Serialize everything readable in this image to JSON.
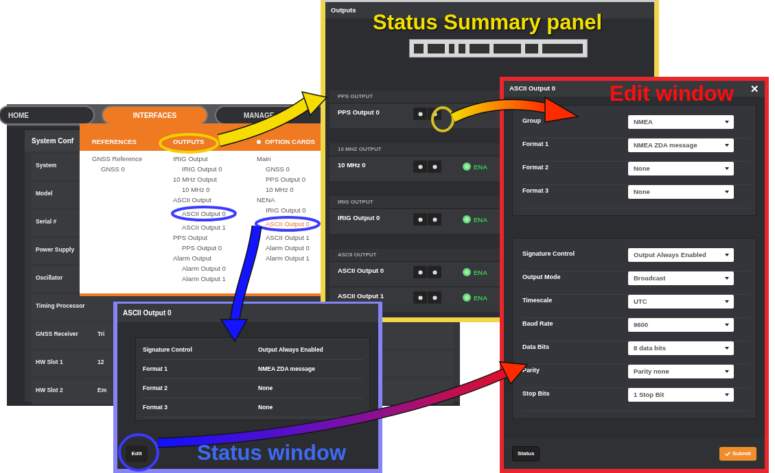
{
  "system_screen": {
    "nav_tabs": [
      {
        "label": "HOME",
        "selected": false
      },
      {
        "label": "INTERFACES",
        "selected": true
      },
      {
        "label": "MANAGE",
        "selected": false
      }
    ],
    "panel_title": "System Conf",
    "rows": [
      {
        "label": "System"
      },
      {
        "label": "Model"
      },
      {
        "label": "Serial #"
      },
      {
        "label": "Power Supply"
      },
      {
        "label": "Oscillator"
      },
      {
        "label": "Timing Processor"
      },
      {
        "label": "GNSS Receiver",
        "value": "Tri"
      },
      {
        "label": "HW Slot 1",
        "value": "12"
      },
      {
        "label": "HW Slot 2",
        "value": "Em"
      }
    ]
  },
  "interfaces_menu": {
    "columns": [
      {
        "heading": "REFERENCES",
        "dot": false,
        "items": [
          {
            "label": "GNSS Reference",
            "selected": false,
            "children": [
              {
                "label": "GNSS 0",
                "selected": false
              }
            ]
          }
        ]
      },
      {
        "heading": "OUTPUTS",
        "dot": false,
        "items": [
          {
            "label": "IRIG Output",
            "selected": false,
            "children": [
              {
                "label": "IRIG Output 0",
                "selected": false
              }
            ]
          },
          {
            "label": "10 MHz Output",
            "selected": false,
            "children": [
              {
                "label": "10 MHz 0",
                "selected": false
              }
            ]
          },
          {
            "label": "ASCII Output",
            "selected": false,
            "children": [
              {
                "label": "ASCII Output 0",
                "selected": false
              },
              {
                "label": "ASCII Output 1",
                "selected": false
              }
            ]
          },
          {
            "label": "PPS Output",
            "selected": false,
            "children": [
              {
                "label": "PPS Output 0",
                "selected": false
              }
            ]
          },
          {
            "label": "Alarm Output",
            "selected": false,
            "children": [
              {
                "label": "Alarm Output 0",
                "selected": false
              },
              {
                "label": "Alarm Output 1",
                "selected": false
              }
            ]
          }
        ]
      },
      {
        "heading": "OPTION CARDS",
        "dot": true,
        "items": [
          {
            "label": "Main",
            "selected": false,
            "children": [
              {
                "label": "GNSS 0",
                "selected": false
              },
              {
                "label": "PPS Output 0",
                "selected": false
              },
              {
                "label": "10 MHz 0",
                "selected": false
              }
            ]
          },
          {
            "label": "NENA",
            "selected": false,
            "children": [
              {
                "label": "IRIG Output 0",
                "selected": false
              },
              {
                "label": "ASCII Output 0",
                "selected": true
              },
              {
                "label": "ASCII Output 1",
                "selected": false
              },
              {
                "label": "Alarm Output 0",
                "selected": false
              },
              {
                "label": "Alarm Output 1",
                "selected": false
              }
            ]
          }
        ]
      }
    ]
  },
  "outputs_panel": {
    "title": "Outputs",
    "annotation": "Status Summary panel",
    "sections": [
      {
        "heading": "PPS OUTPUT",
        "rows": [
          {
            "name": "PPS Output 0"
          }
        ]
      },
      {
        "heading": "10 MHZ OUTPUT",
        "rows": [
          {
            "name": "10 MHz 0",
            "enabled": true,
            "status": "ENA"
          }
        ]
      },
      {
        "heading": "IRIG OUTPUT",
        "rows": [
          {
            "name": "IRIG Output 0",
            "enabled": true,
            "status": "ENA"
          }
        ]
      },
      {
        "heading": "ASCII OUTPUT",
        "rows": [
          {
            "name": "ASCII Output 0",
            "enabled": true,
            "status": "ENA"
          },
          {
            "name": "ASCII Output 1",
            "enabled": true,
            "status": "ENA"
          }
        ]
      }
    ]
  },
  "status_window": {
    "title": "ASCII Output 0",
    "annotation": "Status window",
    "rows": [
      {
        "label": "Signature Control",
        "value": "Output Always Enabled"
      },
      {
        "label": "Format 1",
        "value": "NMEA ZDA message"
      },
      {
        "label": "Format 2",
        "value": "None"
      },
      {
        "label": "Format 3",
        "value": "None"
      }
    ],
    "edit_button": "Edit"
  },
  "edit_window": {
    "title": "ASCII Output 0",
    "close": "✕",
    "annotation": "Edit window",
    "groups": [
      [
        {
          "label": "Group",
          "value": "NMEA"
        },
        {
          "label": "Format 1",
          "value": "NMEA ZDA message"
        },
        {
          "label": "Format 2",
          "value": "None"
        },
        {
          "label": "Format 3",
          "value": "None"
        }
      ],
      [
        {
          "label": "Signature Control",
          "value": "Output Always Enabled"
        },
        {
          "label": "Output Mode",
          "value": "Broadcast"
        },
        {
          "label": "Timescale",
          "value": "UTC"
        },
        {
          "label": "Baud Rate",
          "value": "9600"
        },
        {
          "label": "Data Bits",
          "value": "8 data bits"
        },
        {
          "label": "Parity",
          "value": "Parity none"
        },
        {
          "label": "Stop Bits",
          "value": "1 Stop Bit"
        }
      ]
    ],
    "status_button": "Status",
    "submit_button": "Submit"
  }
}
